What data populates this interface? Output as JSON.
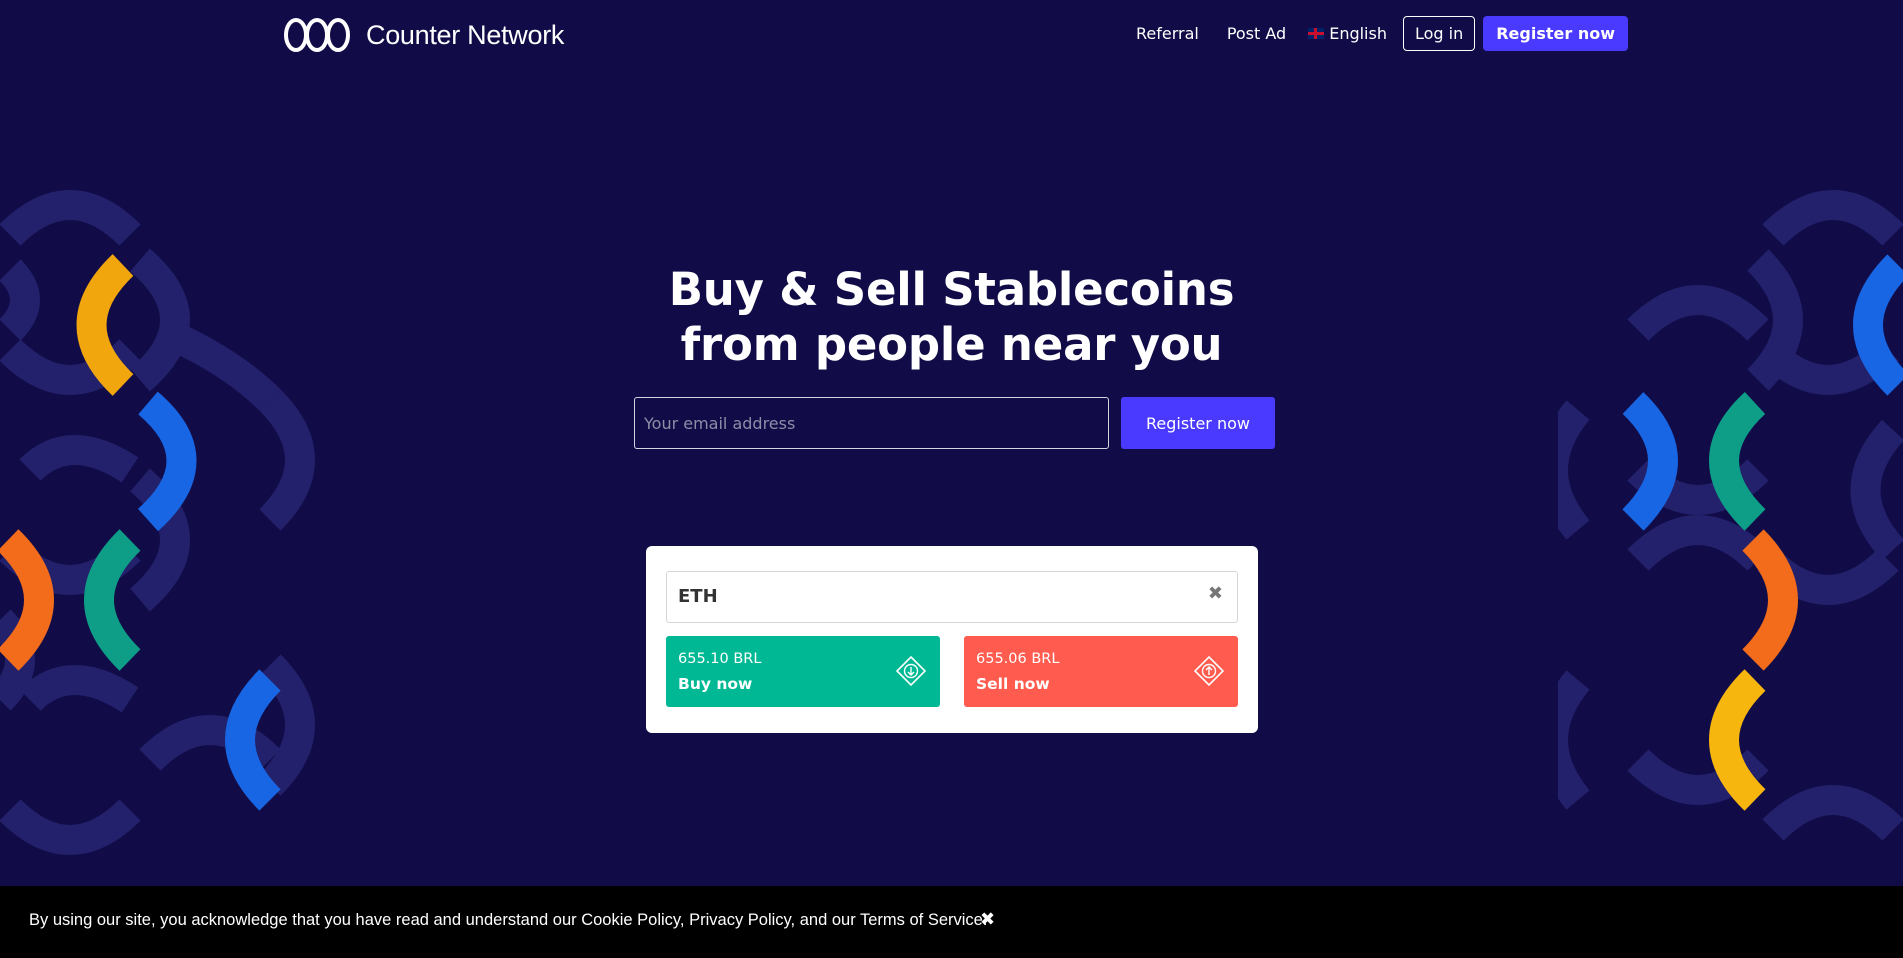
{
  "brand": {
    "name": "Counter Network"
  },
  "nav": {
    "links": [
      "Referral",
      "Post Ad"
    ],
    "language": "English",
    "login_label": "Log in",
    "register_label": "Register now"
  },
  "hero": {
    "title_line1": "Buy & Sell Stablecoins",
    "title_line2": "from people near you"
  },
  "signup": {
    "email_placeholder": "Your email address",
    "button_label": "Register now"
  },
  "market": {
    "selected_coin": "ETH",
    "buy": {
      "price": "655.10 BRL",
      "label": "Buy now"
    },
    "sell": {
      "price": "655.06 BRL",
      "label": "Sell now"
    }
  },
  "cookie_banner": {
    "text": "By using our site, you acknowledge that you have read and understand our Cookie Policy, Privacy Policy, and our Terms of Service."
  },
  "colors": {
    "background": "#110c47",
    "accent": "#4a3aff",
    "buy": "#00b894",
    "sell": "#ff5b4e"
  }
}
